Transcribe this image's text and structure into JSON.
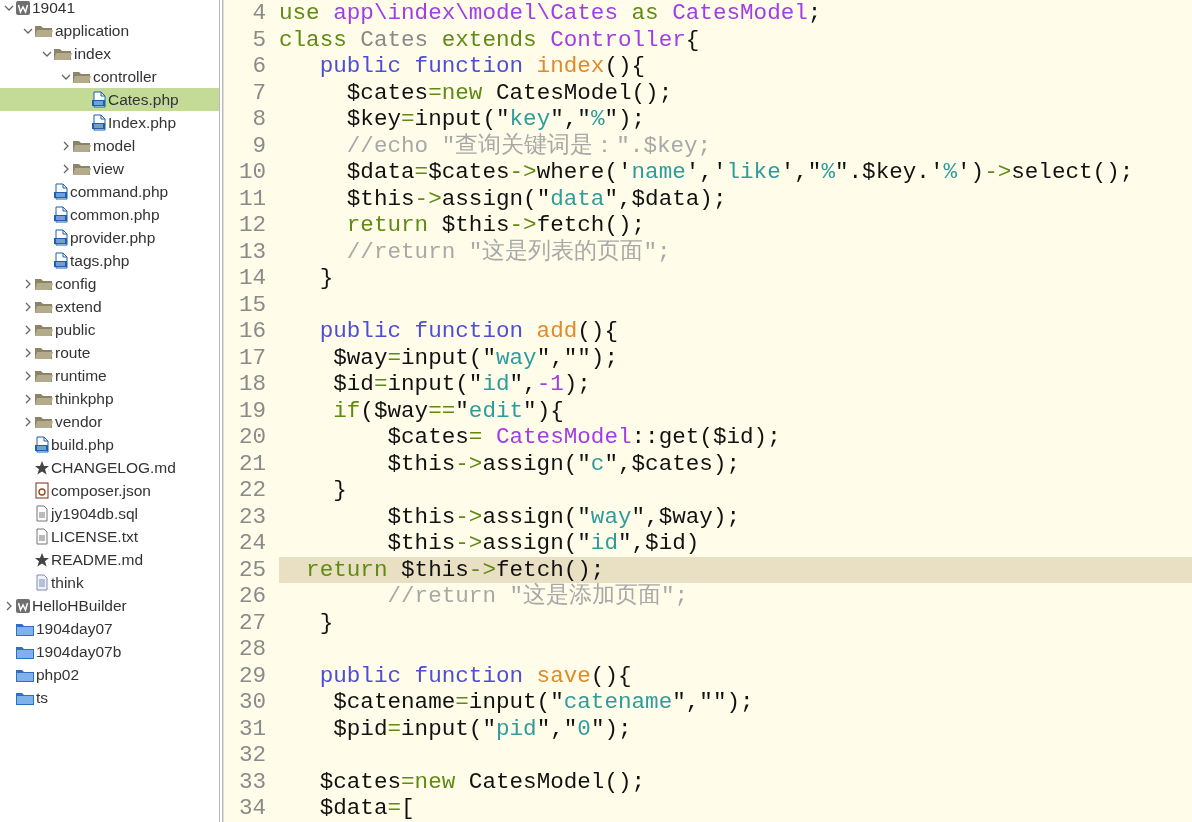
{
  "tree": [
    {
      "name": "19041",
      "kind": "project",
      "expanded": true,
      "selected": false,
      "children": [
        {
          "name": "application",
          "kind": "folder",
          "expanded": true,
          "selected": false,
          "children": [
            {
              "name": "index",
              "kind": "folder",
              "expanded": true,
              "selected": false,
              "children": [
                {
                  "name": "controller",
                  "kind": "folder",
                  "expanded": true,
                  "selected": false,
                  "children": [
                    {
                      "name": "Cates.php",
                      "kind": "php",
                      "selected": true
                    },
                    {
                      "name": "Index.php",
                      "kind": "php",
                      "selected": false
                    }
                  ]
                },
                {
                  "name": "model",
                  "kind": "folder",
                  "expanded": false,
                  "selected": false
                },
                {
                  "name": "view",
                  "kind": "folder",
                  "expanded": false,
                  "selected": false
                }
              ]
            },
            {
              "name": "command.php",
              "kind": "php",
              "selected": false
            },
            {
              "name": "common.php",
              "kind": "php",
              "selected": false
            },
            {
              "name": "provider.php",
              "kind": "php",
              "selected": false
            },
            {
              "name": "tags.php",
              "kind": "php",
              "selected": false
            }
          ]
        },
        {
          "name": "config",
          "kind": "folder",
          "expanded": false,
          "selected": false
        },
        {
          "name": "extend",
          "kind": "folder",
          "expanded": false,
          "selected": false
        },
        {
          "name": "public",
          "kind": "folder",
          "expanded": false,
          "selected": false
        },
        {
          "name": "route",
          "kind": "folder",
          "expanded": false,
          "selected": false
        },
        {
          "name": "runtime",
          "kind": "folder",
          "expanded": false,
          "selected": false
        },
        {
          "name": "thinkphp",
          "kind": "folder",
          "expanded": false,
          "selected": false
        },
        {
          "name": "vendor",
          "kind": "folder",
          "expanded": false,
          "selected": false
        },
        {
          "name": "build.php",
          "kind": "php",
          "selected": false
        },
        {
          "name": "CHANGELOG.md",
          "kind": "star",
          "selected": false
        },
        {
          "name": "composer.json",
          "kind": "composer",
          "selected": false
        },
        {
          "name": "jy1904db.sql",
          "kind": "text",
          "selected": false
        },
        {
          "name": "LICENSE.txt",
          "kind": "text",
          "selected": false
        },
        {
          "name": "README.md",
          "kind": "star",
          "selected": false
        },
        {
          "name": "think",
          "kind": "doc",
          "selected": false
        }
      ]
    },
    {
      "name": "HelloHBuilder",
      "kind": "project",
      "expanded": false,
      "selected": false
    },
    {
      "name": "1904day07",
      "kind": "box",
      "selected": false
    },
    {
      "name": "1904day07b",
      "kind": "box",
      "selected": false
    },
    {
      "name": "php02",
      "kind": "box",
      "selected": false
    },
    {
      "name": "ts",
      "kind": "box",
      "selected": false
    }
  ],
  "editor": {
    "lines": [
      {
        "number": "4",
        "current": false,
        "tokens": [
          {
            "kind": "kw",
            "text": "use"
          },
          {
            "kind": "cls",
            "text": " app\\index\\model\\Cates"
          },
          {
            "kind": "kw",
            "text": " as"
          },
          {
            "kind": "cls",
            "text": " CatesModel"
          },
          {
            "kind": "plain",
            "text": ";"
          }
        ]
      },
      {
        "number": "5",
        "current": false,
        "tokens": [
          {
            "kind": "kw",
            "text": "class"
          },
          {
            "kind": "name",
            "text": " Cates"
          },
          {
            "kind": "kw",
            "text": " extends"
          },
          {
            "kind": "cls",
            "text": " Controller"
          },
          {
            "kind": "plain",
            "text": "{"
          }
        ]
      },
      {
        "number": "6",
        "current": false,
        "tokens": [
          {
            "kind": "decl",
            "text": "   public"
          },
          {
            "kind": "decl",
            "text": " function"
          },
          {
            "kind": "fn",
            "text": " index"
          },
          {
            "kind": "plain",
            "text": "(){"
          }
        ]
      },
      {
        "number": "7",
        "current": false,
        "tokens": [
          {
            "kind": "plain",
            "text": "     $cates"
          },
          {
            "kind": "op",
            "text": "="
          },
          {
            "kind": "kw",
            "text": "new"
          },
          {
            "kind": "plain",
            "text": " CatesModel();"
          }
        ]
      },
      {
        "number": "8",
        "current": false,
        "tokens": [
          {
            "kind": "plain",
            "text": "     $key"
          },
          {
            "kind": "op",
            "text": "="
          },
          {
            "kind": "plain",
            "text": "input(\""
          },
          {
            "kind": "str",
            "text": "key"
          },
          {
            "kind": "plain",
            "text": "\",\""
          },
          {
            "kind": "str",
            "text": "%"
          },
          {
            "kind": "plain",
            "text": "\");"
          }
        ]
      },
      {
        "number": "9",
        "current": false,
        "tokens": [
          {
            "kind": "com",
            "text": "     //echo \"查询关键词是：\".$key;"
          }
        ]
      },
      {
        "number": "10",
        "current": false,
        "tokens": [
          {
            "kind": "plain",
            "text": "     $data"
          },
          {
            "kind": "op",
            "text": "="
          },
          {
            "kind": "plain",
            "text": "$cates"
          },
          {
            "kind": "op",
            "text": "->"
          },
          {
            "kind": "plain",
            "text": "where('"
          },
          {
            "kind": "str",
            "text": "name"
          },
          {
            "kind": "plain",
            "text": "','"
          },
          {
            "kind": "str",
            "text": "like"
          },
          {
            "kind": "plain",
            "text": "',\""
          },
          {
            "kind": "str",
            "text": "%"
          },
          {
            "kind": "plain",
            "text": "\".$key.'"
          },
          {
            "kind": "str",
            "text": "%"
          },
          {
            "kind": "plain",
            "text": "')"
          },
          {
            "kind": "op",
            "text": "->"
          },
          {
            "kind": "plain",
            "text": "select();"
          }
        ]
      },
      {
        "number": "11",
        "current": false,
        "tokens": [
          {
            "kind": "plain",
            "text": "     $this"
          },
          {
            "kind": "op",
            "text": "->"
          },
          {
            "kind": "plain",
            "text": "assign(\""
          },
          {
            "kind": "str",
            "text": "data"
          },
          {
            "kind": "plain",
            "text": "\",$data);"
          }
        ]
      },
      {
        "number": "12",
        "current": false,
        "tokens": [
          {
            "kind": "kw",
            "text": "     return"
          },
          {
            "kind": "plain",
            "text": " $this"
          },
          {
            "kind": "op",
            "text": "->"
          },
          {
            "kind": "plain",
            "text": "fetch();"
          }
        ]
      },
      {
        "number": "13",
        "current": false,
        "tokens": [
          {
            "kind": "com",
            "text": "     //return \"这是列表的页面\";"
          }
        ]
      },
      {
        "number": "14",
        "current": false,
        "tokens": [
          {
            "kind": "plain",
            "text": "   }"
          }
        ]
      },
      {
        "number": "15",
        "current": false
      },
      {
        "number": "16",
        "current": false,
        "tokens": [
          {
            "kind": "decl",
            "text": "   public"
          },
          {
            "kind": "decl",
            "text": " function"
          },
          {
            "kind": "fn",
            "text": " add"
          },
          {
            "kind": "plain",
            "text": "(){"
          }
        ]
      },
      {
        "number": "17",
        "current": false,
        "tokens": [
          {
            "kind": "plain",
            "text": "    $way"
          },
          {
            "kind": "op",
            "text": "="
          },
          {
            "kind": "plain",
            "text": "input(\""
          },
          {
            "kind": "str",
            "text": "way"
          },
          {
            "kind": "plain",
            "text": "\",\"\");"
          }
        ]
      },
      {
        "number": "18",
        "current": false,
        "tokens": [
          {
            "kind": "plain",
            "text": "    $id"
          },
          {
            "kind": "op",
            "text": "="
          },
          {
            "kind": "plain",
            "text": "input(\""
          },
          {
            "kind": "str",
            "text": "id"
          },
          {
            "kind": "plain",
            "text": "\","
          },
          {
            "kind": "num",
            "text": "-1"
          },
          {
            "kind": "plain",
            "text": ");"
          }
        ]
      },
      {
        "number": "19",
        "current": false,
        "tokens": [
          {
            "kind": "kw",
            "text": "    if"
          },
          {
            "kind": "plain",
            "text": "($way"
          },
          {
            "kind": "op",
            "text": "=="
          },
          {
            "kind": "plain",
            "text": "\""
          },
          {
            "kind": "str",
            "text": "edit"
          },
          {
            "kind": "plain",
            "text": "\"){"
          }
        ]
      },
      {
        "number": "20",
        "current": false,
        "tokens": [
          {
            "kind": "plain",
            "text": "        $cates"
          },
          {
            "kind": "op",
            "text": "="
          },
          {
            "kind": "cls",
            "text": " CatesModel"
          },
          {
            "kind": "plain",
            "text": "::get($id);"
          }
        ]
      },
      {
        "number": "21",
        "current": false,
        "tokens": [
          {
            "kind": "plain",
            "text": "        $this"
          },
          {
            "kind": "op",
            "text": "->"
          },
          {
            "kind": "plain",
            "text": "assign(\""
          },
          {
            "kind": "str",
            "text": "c"
          },
          {
            "kind": "plain",
            "text": "\",$cates);"
          }
        ]
      },
      {
        "number": "22",
        "current": false,
        "tokens": [
          {
            "kind": "plain",
            "text": "    }"
          }
        ]
      },
      {
        "number": "23",
        "current": false,
        "tokens": [
          {
            "kind": "plain",
            "text": "        $this"
          },
          {
            "kind": "op",
            "text": "->"
          },
          {
            "kind": "plain",
            "text": "assign(\""
          },
          {
            "kind": "str",
            "text": "way"
          },
          {
            "kind": "plain",
            "text": "\",$way);"
          }
        ]
      },
      {
        "number": "24",
        "current": false,
        "tokens": [
          {
            "kind": "plain",
            "text": "        $this"
          },
          {
            "kind": "op",
            "text": "->"
          },
          {
            "kind": "plain",
            "text": "assign(\""
          },
          {
            "kind": "str",
            "text": "id"
          },
          {
            "kind": "plain",
            "text": "\",$id)"
          }
        ]
      },
      {
        "number": "25",
        "current": true,
        "tokens": [
          {
            "kind": "kw",
            "text": "  return"
          },
          {
            "kind": "plain",
            "text": " $this"
          },
          {
            "kind": "op",
            "text": "->"
          },
          {
            "kind": "plain",
            "text": "fetch();"
          }
        ]
      },
      {
        "number": "26",
        "current": false,
        "tokens": [
          {
            "kind": "com",
            "text": "        //return \"这是添加页面\";"
          }
        ]
      },
      {
        "number": "27",
        "current": false,
        "tokens": [
          {
            "kind": "plain",
            "text": "   }"
          }
        ]
      },
      {
        "number": "28",
        "current": false
      },
      {
        "number": "29",
        "current": false,
        "tokens": [
          {
            "kind": "decl",
            "text": "   public"
          },
          {
            "kind": "decl",
            "text": " function"
          },
          {
            "kind": "fn",
            "text": " save"
          },
          {
            "kind": "plain",
            "text": "(){"
          }
        ]
      },
      {
        "number": "30",
        "current": false,
        "tokens": [
          {
            "kind": "plain",
            "text": "    $catename"
          },
          {
            "kind": "op",
            "text": "="
          },
          {
            "kind": "plain",
            "text": "input(\""
          },
          {
            "kind": "str",
            "text": "catename"
          },
          {
            "kind": "plain",
            "text": "\",\"\");"
          }
        ]
      },
      {
        "number": "31",
        "current": false,
        "tokens": [
          {
            "kind": "plain",
            "text": "    $pid"
          },
          {
            "kind": "op",
            "text": "="
          },
          {
            "kind": "plain",
            "text": "input(\""
          },
          {
            "kind": "str",
            "text": "pid"
          },
          {
            "kind": "plain",
            "text": "\",\""
          },
          {
            "kind": "str",
            "text": "0"
          },
          {
            "kind": "plain",
            "text": "\");"
          }
        ]
      },
      {
        "number": "32",
        "current": false
      },
      {
        "number": "33",
        "current": false,
        "tokens": [
          {
            "kind": "plain",
            "text": "   $cates"
          },
          {
            "kind": "op",
            "text": "="
          },
          {
            "kind": "kw",
            "text": "new"
          },
          {
            "kind": "plain",
            "text": " CatesModel();"
          }
        ]
      },
      {
        "number": "34",
        "current": false,
        "tokens": [
          {
            "kind": "plain",
            "text": "   $data"
          },
          {
            "kind": "op",
            "text": "="
          },
          {
            "kind": "plain",
            "text": "["
          }
        ]
      }
    ]
  }
}
